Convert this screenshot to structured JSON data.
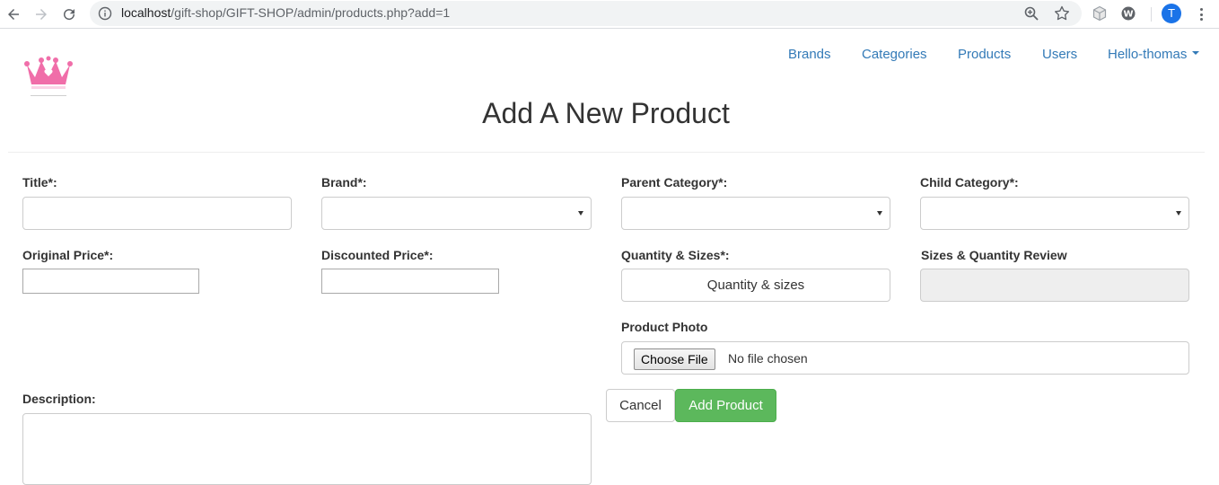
{
  "browser": {
    "url_host": "localhost",
    "url_path": "/gift-shop/GIFT-SHOP/admin/products.php?add=1",
    "profile_initial": "T"
  },
  "nav": {
    "brands": "Brands",
    "categories": "Categories",
    "products": "Products",
    "users": "Users",
    "account": "Hello-thomas"
  },
  "page": {
    "title": "Add A New Product"
  },
  "form": {
    "title_label": "Title*:",
    "brand_label": "Brand*:",
    "parent_category_label": "Parent Category*:",
    "child_category_label": "Child Category*:",
    "original_price_label": "Original Price*:",
    "discounted_price_label": "Discounted Price*:",
    "quantity_sizes_label": "Quantity & Sizes*:",
    "quantity_sizes_button": "Quantity & sizes",
    "sizes_review_label": "Sizes & Quantity Review",
    "photo_label": "Product Photo",
    "choose_file": "Choose File",
    "no_file": "No file chosen",
    "description_label": "Description:",
    "cancel": "Cancel",
    "add_product": "Add Product"
  },
  "colors": {
    "link": "#337ab7",
    "success": "#5cb85c",
    "logo_pink": "#f06ea9"
  }
}
